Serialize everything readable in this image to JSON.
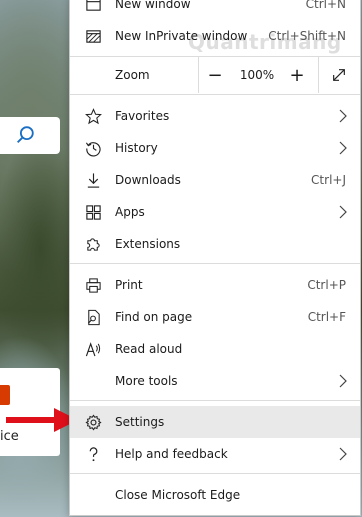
{
  "menu": {
    "new_window": {
      "label": "New window",
      "shortcut": "Ctrl+N"
    },
    "new_inprivate": {
      "label": "New InPrivate window",
      "shortcut": "Ctrl+Shift+N"
    },
    "zoom": {
      "label": "Zoom",
      "minus": "−",
      "value": "100%",
      "plus": "+"
    },
    "favorites": {
      "label": "Favorites"
    },
    "history": {
      "label": "History"
    },
    "downloads": {
      "label": "Downloads",
      "shortcut": "Ctrl+J"
    },
    "apps": {
      "label": "Apps"
    },
    "extensions": {
      "label": "Extensions"
    },
    "print": {
      "label": "Print",
      "shortcut": "Ctrl+P"
    },
    "find_on_page": {
      "label": "Find on page",
      "shortcut": "Ctrl+F"
    },
    "read_aloud": {
      "label": "Read aloud"
    },
    "more_tools": {
      "label": "More tools"
    },
    "settings": {
      "label": "Settings"
    },
    "help_feedback": {
      "label": "Help and feedback"
    },
    "close_edge": {
      "label": "Close Microsoft Edge"
    }
  },
  "background": {
    "office_card_text": "ice"
  },
  "watermark": "Quantrimang",
  "colors": {
    "highlight": "#e9e9e9",
    "annotation_arrow": "#e0101a",
    "office_accent": "#d83b01"
  }
}
